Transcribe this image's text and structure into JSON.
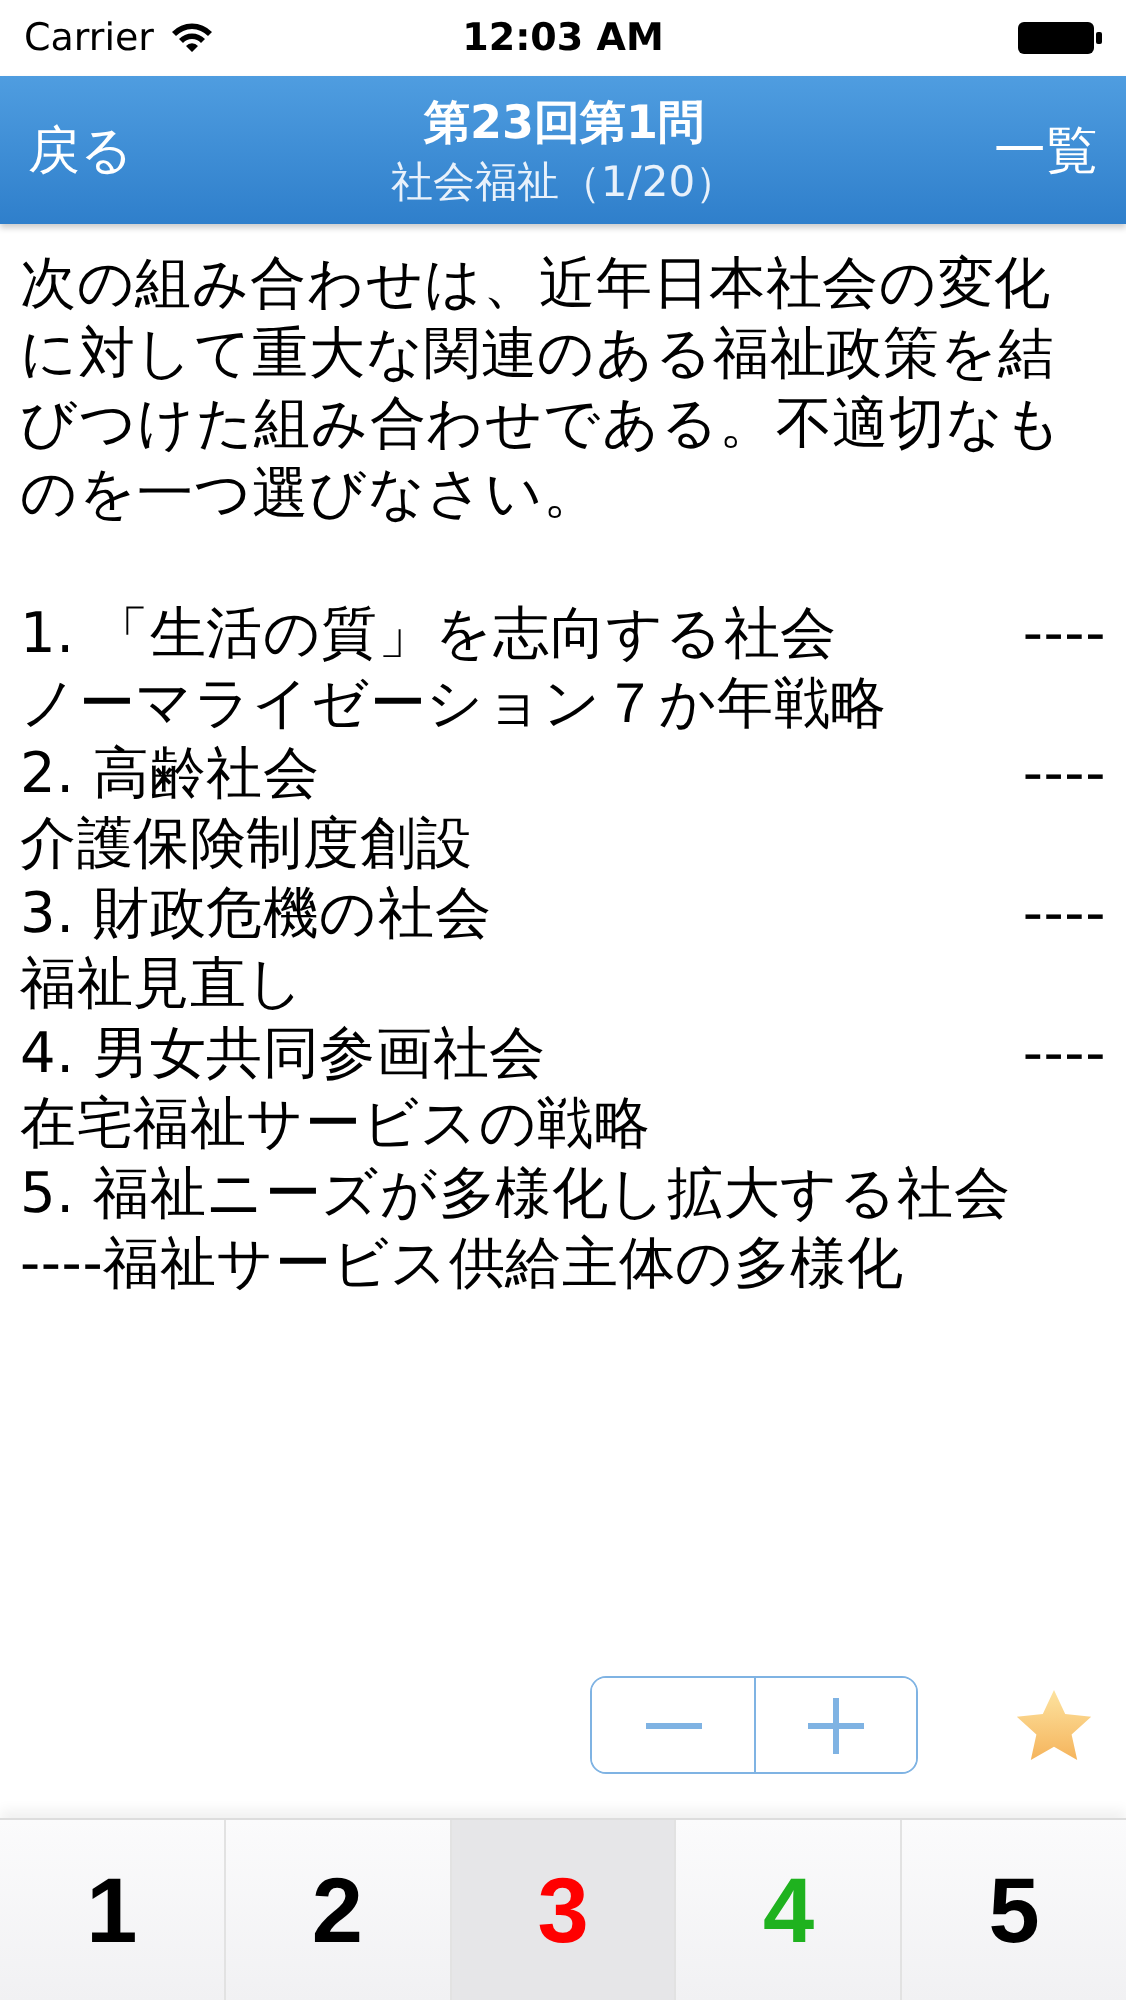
{
  "status_bar": {
    "carrier": "Carrier",
    "time": "12:03 AM"
  },
  "nav_bar": {
    "back": "戻る",
    "title": "第23回第1問",
    "subtitle": "社会福祉（1/20）",
    "list": "一覧"
  },
  "question": "次の組み合わせは、近年日本社会の変化に対して重大な関連のある福祉政策を結びつけた組み合わせである。不適切なものを一つ選びなさい。",
  "options": [
    {
      "head": "1. 「生活の質」を志向する社会",
      "dash": "----",
      "tail": "ノーマライゼーション７か年戦略"
    },
    {
      "head": "2. 高齢社会",
      "dash": "----",
      "tail": "介護保険制度創設"
    },
    {
      "head": "3. 財政危機の社会",
      "dash": "----",
      "tail": "福祉見直し"
    },
    {
      "head": "4. 男女共同参画社会",
      "dash": "----",
      "tail": "在宅福祉サービスの戦略"
    },
    {
      "head": "5. 福祉ニーズが多様化し拡大する社会",
      "tail": "----福祉サービス供給主体の多様化"
    }
  ],
  "answers": [
    {
      "label": "1",
      "color": "#000000",
      "selected": false
    },
    {
      "label": "2",
      "color": "#000000",
      "selected": false
    },
    {
      "label": "3",
      "color": "#ff0000",
      "selected": true
    },
    {
      "label": "4",
      "color": "#1fb21f",
      "selected": false
    },
    {
      "label": "5",
      "color": "#000000",
      "selected": false
    }
  ]
}
